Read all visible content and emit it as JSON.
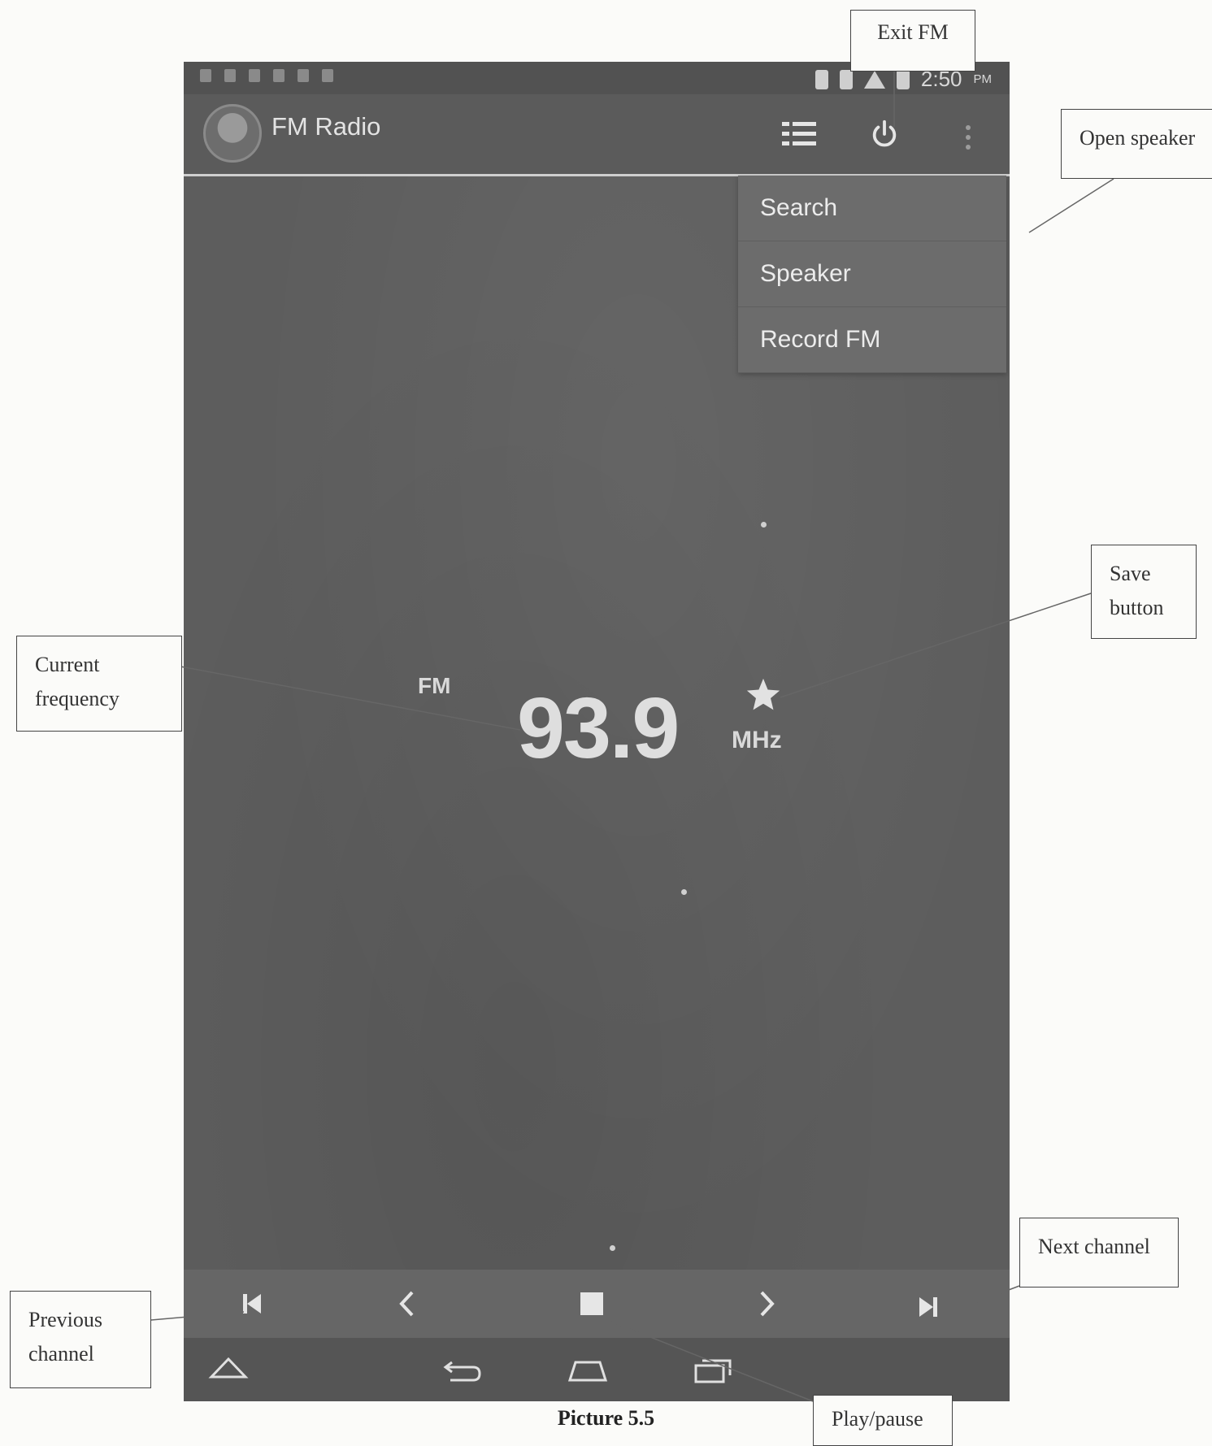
{
  "status_bar": {
    "time": "2:50",
    "ampm": "PM"
  },
  "app_bar": {
    "title": "FM Radio"
  },
  "menu": {
    "items": [
      "Search",
      "Speaker",
      "Record FM"
    ]
  },
  "tuner": {
    "band": "FM",
    "frequency": "93.9",
    "unit": "MHz"
  },
  "callouts": {
    "exit_fm": "Exit FM",
    "open_speaker": "Open speaker",
    "save_button_line1": "Save",
    "save_button_line2": "button",
    "current_frequency_line1": "Current",
    "current_frequency_line2": "frequency",
    "next_channel": "Next channel",
    "previous_channel_line1": "Previous",
    "previous_channel_line2": "channel",
    "play_pause": "Play/pause"
  },
  "caption": "Picture 5.5",
  "icons": [
    "list-icon",
    "power-icon",
    "overflow-menu-icon",
    "star-icon",
    "skip-previous-icon",
    "chevron-left-icon",
    "stop-icon",
    "chevron-right-icon",
    "skip-next-icon",
    "nav-up-icon",
    "nav-back-icon",
    "nav-home-icon",
    "nav-recents-icon"
  ]
}
